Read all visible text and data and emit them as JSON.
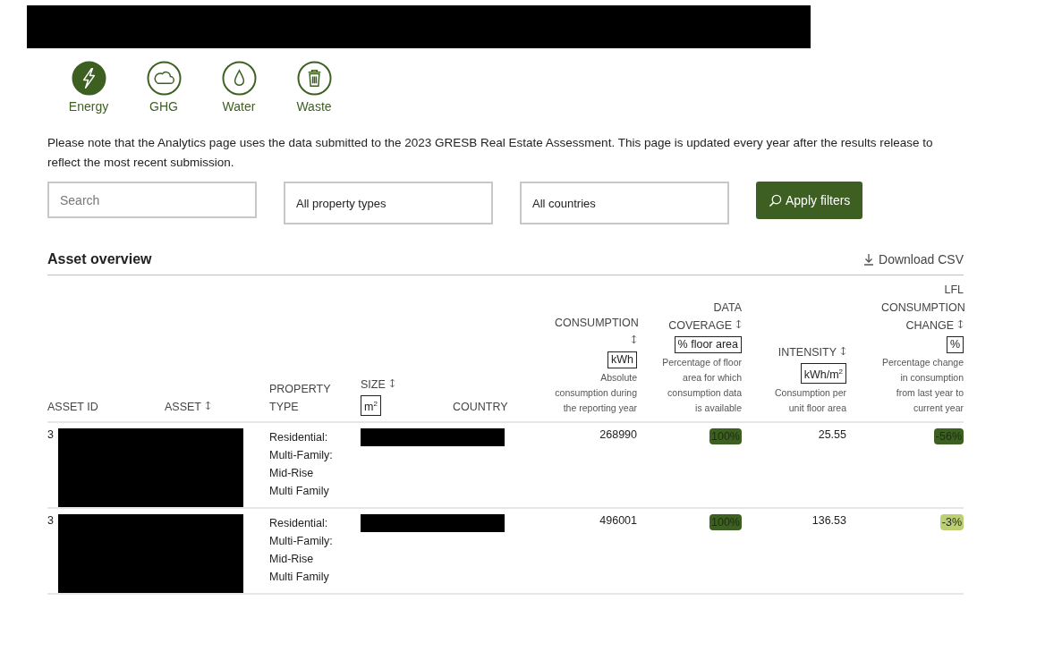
{
  "categories": [
    {
      "label": "Energy",
      "selected": true
    },
    {
      "label": "GHG",
      "selected": false
    },
    {
      "label": "Water",
      "selected": false
    },
    {
      "label": "Waste",
      "selected": false
    }
  ],
  "notice": "Please note that the Analytics page uses the data submitted to the 2023 GRESB Real Estate Assessment. This page is updated every year after the results release to reflect the most recent submission.",
  "filters": {
    "search": {
      "placeholder": "Search"
    },
    "property_type": "All property types",
    "country": "All countries",
    "apply_button": "Apply filters"
  },
  "section_title": "Asset overview",
  "download_link": "Download CSV",
  "table": {
    "columns": [
      {
        "label": "ASSET ID",
        "sortable": false
      },
      {
        "label": "ASSET",
        "sortable": true
      },
      {
        "label": "PROPERTY TYPE",
        "sortable": false
      },
      {
        "label": "SIZE",
        "sortable": true,
        "unit": "m$^{2}$"
      },
      {
        "label": "COUNTRY",
        "sortable": false
      },
      {
        "label": "CONSUMPTION",
        "sortable": true,
        "unit": "kWh",
        "description": "Absolute consumption during the reporting year"
      },
      {
        "label": "DATA COVERAGE",
        "sortable": true,
        "unit": "% floor area",
        "description": "Percentage of floor area for which consumption data is available"
      },
      {
        "label": "INTENSITY",
        "sortable": true,
        "unit": "kWh/m$^{2}$",
        "description": "Consumption per unit floor area"
      },
      {
        "label": "LFL CONSUMPTION CHANGE",
        "sortable": true,
        "unit": "%",
        "description": "Percentage change in consumption from last year to current year"
      }
    ],
    "rows": [
      {
        "asset_id": "3",
        "property_type": "Residential: Multi-Family: Mid-Rise Multi Family",
        "consumption": "268990",
        "coverage": {
          "text": "100%",
          "color": "#3d5f22"
        },
        "intensity": "25.55",
        "lfl_change": {
          "text": "-56%",
          "color": "#3d5f22"
        }
      },
      {
        "asset_id": "3",
        "property_type": "Residential: Multi-Family: Mid-Rise Multi Family",
        "consumption": "496001",
        "coverage": {
          "text": "100%",
          "color": "#3d5f22"
        },
        "intensity": "136.53",
        "lfl_change": {
          "text": "-3%",
          "color": "#bccf72"
        }
      }
    ]
  }
}
